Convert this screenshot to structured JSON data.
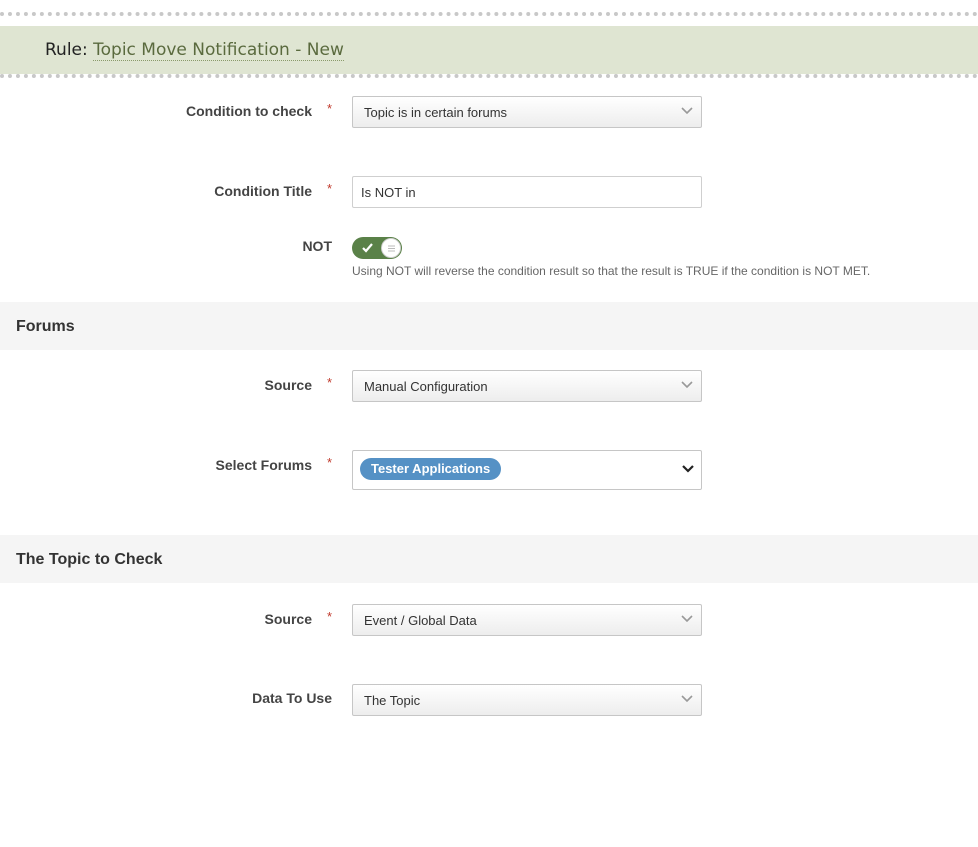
{
  "header": {
    "rule_prefix": "Rule:",
    "rule_name": "Topic Move Notification - New"
  },
  "required_marker": "*",
  "condition": {
    "label": "Condition to check",
    "value": "Topic is in certain forums"
  },
  "condition_title": {
    "label": "Condition Title",
    "value": "Is NOT in"
  },
  "not_toggle": {
    "label": "NOT",
    "on": true,
    "hint": "Using NOT will reverse the condition result so that the result is TRUE if the condition is NOT MET."
  },
  "forums_section": {
    "title": "Forums",
    "source": {
      "label": "Source",
      "value": "Manual Configuration"
    },
    "select_forums": {
      "label": "Select Forums",
      "tags": [
        "Tester Applications"
      ]
    }
  },
  "topic_section": {
    "title": "The Topic to Check",
    "source": {
      "label": "Source",
      "value": "Event / Global Data"
    },
    "data_to_use": {
      "label": "Data To Use",
      "value": "The Topic"
    }
  },
  "colors": {
    "header_bg": "#dfe5d2",
    "toggle_on": "#5a8148",
    "tag_bg": "#5591c5",
    "required": "#c0392b"
  },
  "icons": {
    "select_arrow": "chevron-down-icon",
    "toggle_check": "check-icon"
  }
}
